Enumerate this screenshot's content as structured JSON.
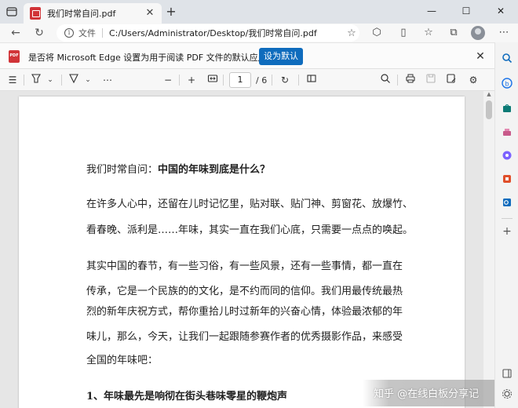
{
  "browser": {
    "tab_title": "我们时常自问.pdf",
    "address_label": "文件",
    "address_url": "C:/Users/Administrator/Desktop/我们时常自问.pdf"
  },
  "infobar": {
    "message": "是否将 Microsoft Edge 设置为用于阅读 PDF 文件的默认应用程序?",
    "button_label": "设为默认"
  },
  "pdf_toolbar": {
    "current_page": "1",
    "total_pages": "/ 6"
  },
  "document": {
    "title_prefix": "我们时常自问：",
    "title_bold": "中国的年味到底是什么？",
    "para1": [
      "在许多人心中，还留在儿时记忆里，贴对联、贴门神、剪窗花、放爆竹、",
      "看春晚、派利是……年味，其实一直在我们心底，只需要一点点的唤起。"
    ],
    "para2": [
      "其实中国的春节，有一些习俗，有一些风景，还有一些事情，都一直在",
      "传承，它是一个民族的的文化，是不约而同的信仰。我们用最传统最热",
      "烈的新年庆祝方式，帮你重拾儿时过新年的兴奋心情，体验最浓郁的年",
      "味儿，那么，今天，让我们一起跟随参赛作者的优秀摄影作品，来感受",
      "全国的年味吧："
    ],
    "heading1": "1、年味最先是响彻在街头巷味零星的鞭炮声"
  },
  "watermark": "知乎 @在线白板分享记",
  "colors": {
    "accent": "#0f6cbd",
    "pdf_red": "#d13438"
  }
}
